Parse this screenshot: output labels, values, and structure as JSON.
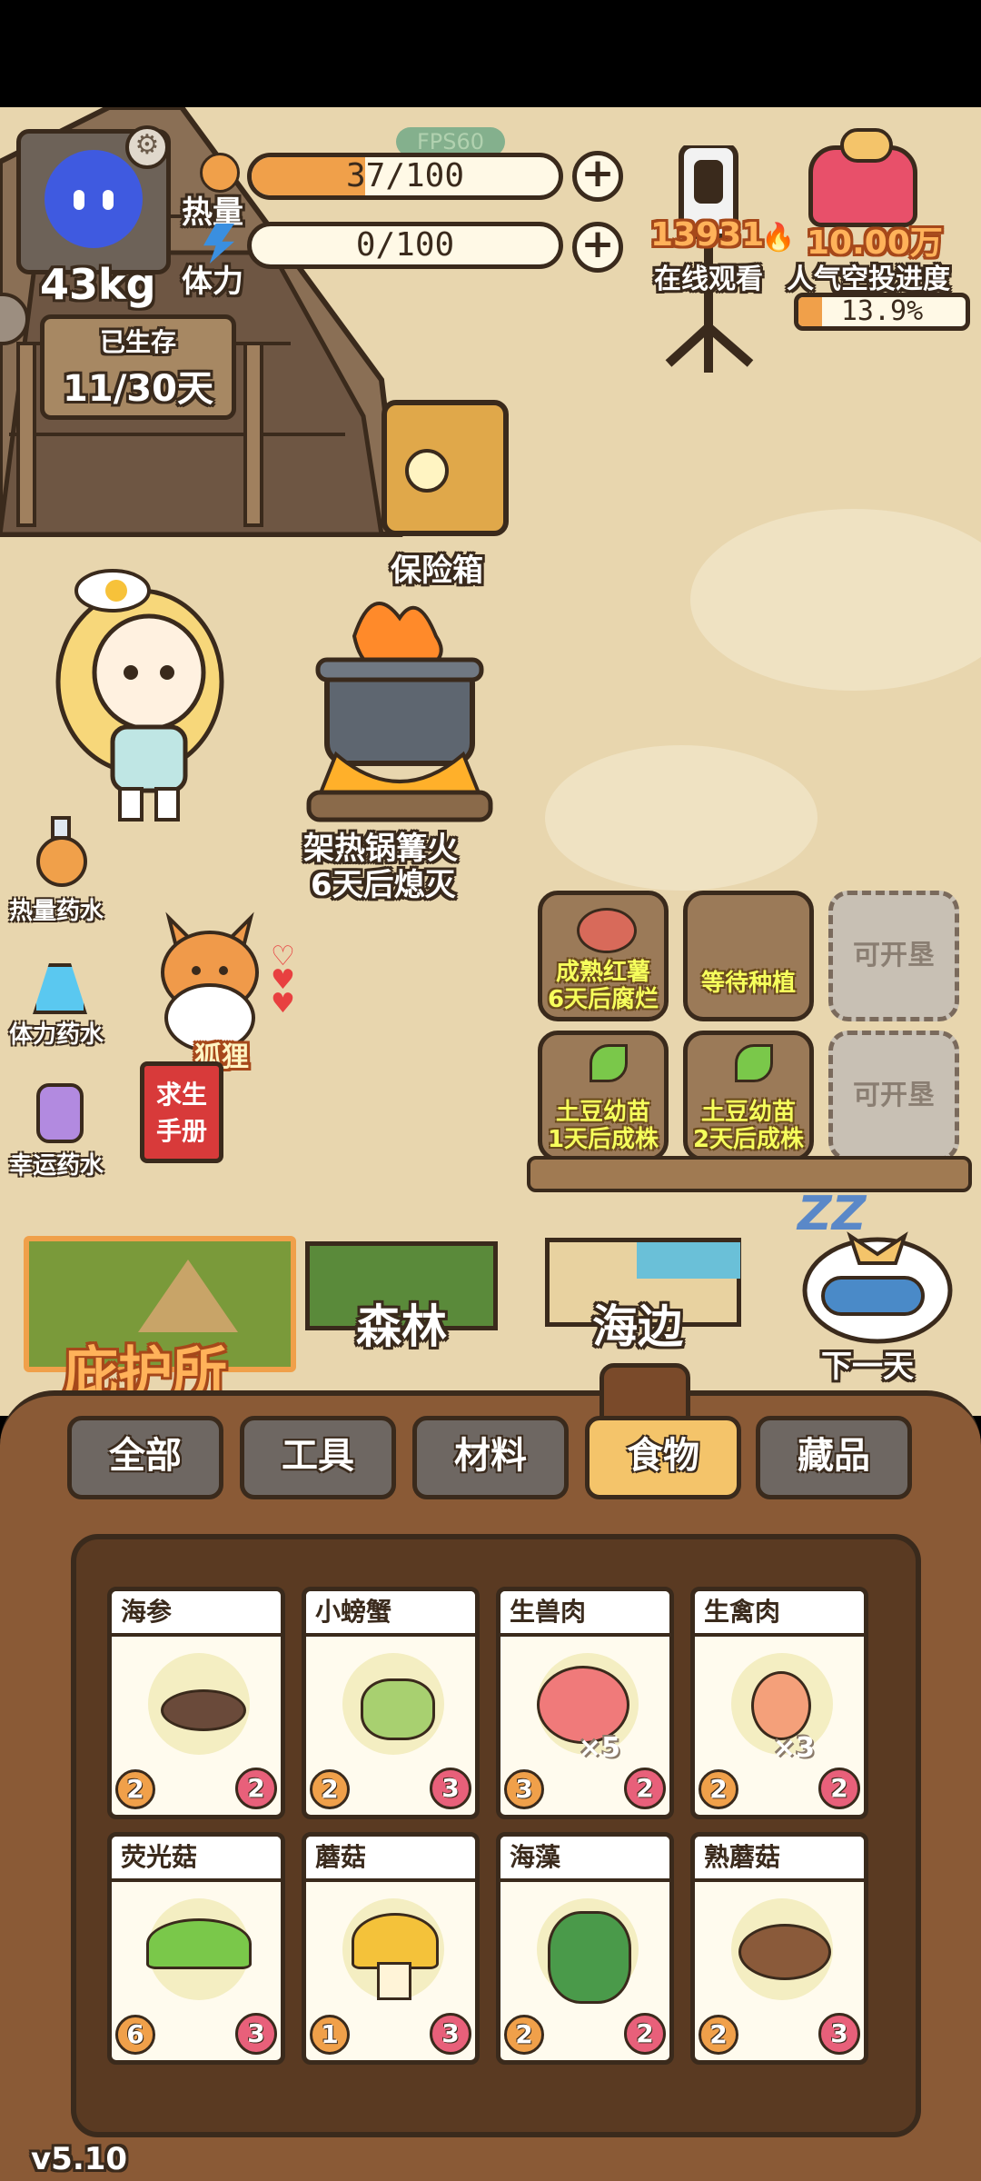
{
  "hud": {
    "fps": "FPS60",
    "weight": "43kg",
    "calorie_label": "热量",
    "calorie_value": "37/100",
    "calorie_fraction": 0.37,
    "stamina_label": "体力",
    "stamina_value": "0/100",
    "stamina_fraction": 0.0,
    "survived_label": "已生存",
    "survived_days": "11/30天",
    "viewers_count": "13931",
    "viewers_label": "在线观看",
    "popularity_count": "10.00万",
    "popularity_label": "人气空投进度",
    "airdrop_progress": "13.9%",
    "airdrop_fraction": 0.139
  },
  "scene": {
    "safe_label": "保险箱",
    "campfire_line1": "架热锅篝火",
    "campfire_line2": "6天后熄灭",
    "fox_label": "狐狸",
    "manual_line1": "求生",
    "manual_line2": "手册",
    "potions": [
      "热量药水",
      "体力药水",
      "幸运药水"
    ]
  },
  "farm": {
    "plots": [
      {
        "line1": "成熟红薯",
        "line2": "6天后腐烂",
        "state": "crop"
      },
      {
        "line1": "等待种植",
        "line2": "",
        "state": "empty"
      },
      {
        "line1": "可开垦",
        "line2": "",
        "state": "locked"
      },
      {
        "line1": "土豆幼苗",
        "line2": "1天后成株",
        "state": "seedling"
      },
      {
        "line1": "土豆幼苗",
        "line2": "2天后成株",
        "state": "seedling"
      },
      {
        "line1": "可开垦",
        "line2": "",
        "state": "locked"
      }
    ]
  },
  "locations": {
    "shelter": "庇护所",
    "forest": "森林",
    "beach": "海边",
    "next_day": "下一天",
    "sleep": "ZZ"
  },
  "tabs": [
    "全部",
    "工具",
    "材料",
    "食物",
    "藏品"
  ],
  "active_tab": "食物",
  "items": [
    {
      "name": "海参",
      "left": "2",
      "right": "2",
      "qty": ""
    },
    {
      "name": "小螃蟹",
      "left": "2",
      "right": "3",
      "qty": ""
    },
    {
      "name": "生兽肉",
      "left": "3",
      "right": "2",
      "qty": "×5"
    },
    {
      "name": "生禽肉",
      "left": "2",
      "right": "2",
      "qty": "×3"
    },
    {
      "name": "荧光菇",
      "left": "6",
      "right": "3",
      "qty": ""
    },
    {
      "name": "蘑菇",
      "left": "1",
      "right": "3",
      "qty": ""
    },
    {
      "name": "海藻",
      "left": "2",
      "right": "2",
      "qty": ""
    },
    {
      "name": "熟蘑菇",
      "left": "2",
      "right": "3",
      "qty": ""
    }
  ],
  "version": "v5.10",
  "colors": {
    "accent": "#f4c46a",
    "bar_fill": "#f0a04a",
    "ground": "#e8d6ae"
  }
}
